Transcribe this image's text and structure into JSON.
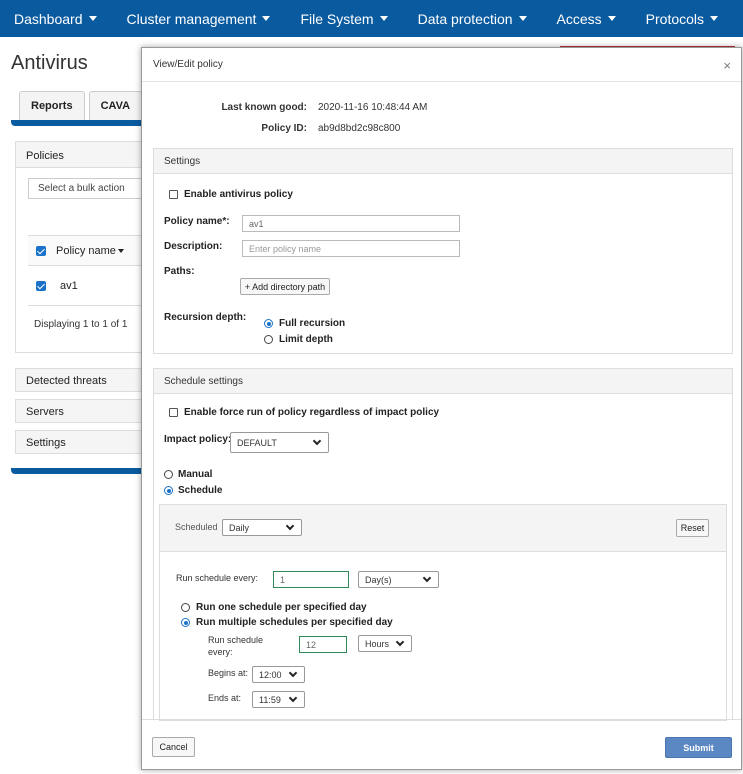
{
  "nav": {
    "items": [
      {
        "label": "Dashboard"
      },
      {
        "label": "Cluster management"
      },
      {
        "label": "File System"
      },
      {
        "label": "Data protection"
      },
      {
        "label": "Access"
      },
      {
        "label": "Protocols"
      }
    ]
  },
  "background": {
    "page_title": "Antivirus",
    "tabs": [
      "Reports",
      "CAVA"
    ],
    "policies_header": "Policies",
    "bulk_action_placeholder": "Select a bulk action",
    "table_header": "Policy name",
    "table_row": "av1",
    "displaying": "Displaying 1 to 1 of 1",
    "collapsed": [
      "Detected threats",
      "Servers",
      "Settings"
    ]
  },
  "modal": {
    "title": "View/Edit policy",
    "close": "×",
    "last_known_good_label": "Last known good:",
    "last_known_good_value": "2020-11-16 10:48:44 AM",
    "policy_id_label": "Policy ID:",
    "policy_id_value": "ab9d8bd2c98c800",
    "settings": {
      "header": "Settings",
      "enable_label": "Enable antivirus policy",
      "policy_name_label": "Policy name*:",
      "policy_name_value": "av1",
      "description_label": "Description:",
      "description_placeholder": "Enter policy name",
      "paths_label": "Paths:",
      "add_path_button": "+ Add directory path",
      "recursion_label": "Recursion depth:",
      "full_recursion": "Full recursion",
      "limit_depth": "Limit depth"
    },
    "schedule": {
      "header": "Schedule settings",
      "force_run_label": "Enable force run of policy regardless of impact policy",
      "impact_label": "Impact policy:",
      "impact_value": "DEFAULT",
      "manual": "Manual",
      "schedule": "Schedule",
      "scheduled_label": "Scheduled",
      "scheduled_value": "Daily",
      "reset_button": "Reset",
      "run_every_label": "Run schedule every:",
      "run_every_value": "1",
      "run_every_unit": "Day(s)",
      "one_per_day": "Run one schedule per specified day",
      "multiple_per_day": "Run multiple schedules per specified day",
      "run_every2_label_1": "Run schedule",
      "run_every2_label_2": "every:",
      "run_every2_value": "12",
      "run_every2_unit": "Hours",
      "begins_label": "Begins at:",
      "begins_value": "12:00",
      "ends_label": "Ends at:",
      "ends_value": "11:59"
    },
    "cancel_button": "Cancel",
    "submit_button": "Submit"
  },
  "colors": {
    "nav_bg": "#0a5aa0",
    "accent_blue": "#1a73c9",
    "submit_bg": "#5b87c2",
    "input_green": "#2e8b57"
  }
}
